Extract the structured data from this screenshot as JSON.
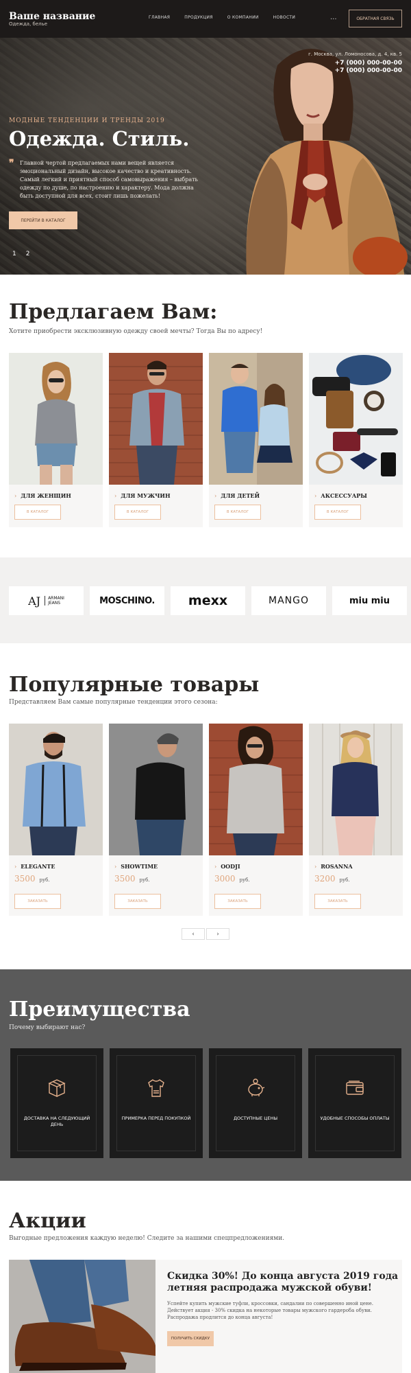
{
  "header": {
    "title": "Ваше название",
    "subtitle": "Одежда, белье",
    "nav": [
      "Главная",
      "Продукция",
      "О компании",
      "Новости"
    ],
    "more": "...",
    "callback_label": "Обратная связь"
  },
  "hero": {
    "address": "г. Москва, ул. Ломоносова, д. 4, кв. 5",
    "phones": [
      "+7 (000) 000-00-00",
      "+7 (000) 000-00-00"
    ],
    "tagline": "Модные тенденции и тренды 2019",
    "title": "Одежда. Стиль.",
    "quote_mark": "❞",
    "quote": "Главной чертой предлагаемых нами вещей является эмоциональный дизайн, высокое качество и креативность. Самый легкий и приятный способ самовыражения – выбрать одежду по душе, по настроению и характеру. Мода должна быть доступной для всех, стоит лишь пожелать!",
    "button_label": "Перейти в каталог",
    "slides": [
      "1",
      "2"
    ]
  },
  "offer": {
    "title": "Предлагаем Вам:",
    "subtitle": "Хотите приобрести эксклюзивную одежду своей мечты? Тогда Вы по адресу!",
    "cards": [
      {
        "name": "Для женщин",
        "button": "В каталог"
      },
      {
        "name": "Для мужчин",
        "button": "В каталог"
      },
      {
        "name": "Для детей",
        "button": "В каталог"
      },
      {
        "name": "Аксессуары",
        "button": "В каталог"
      }
    ]
  },
  "brands": [
    {
      "mark": "AJ",
      "name": "ARMANI",
      "sub": "JEANS"
    },
    {
      "name": "MOSCHINO."
    },
    {
      "name": "mexx"
    },
    {
      "name": "MANGO"
    },
    {
      "name": "miu miu"
    }
  ],
  "popular": {
    "title": "Популярные товары",
    "subtitle": "Представляем Вам самые популярные тенденции этого сезона:",
    "currency": "руб.",
    "items": [
      {
        "name": "Elegante",
        "price": "3500",
        "button": "Заказать"
      },
      {
        "name": "Showtime",
        "price": "3500",
        "button": "Заказать"
      },
      {
        "name": "Oodji",
        "price": "3000",
        "button": "Заказать"
      },
      {
        "name": "Rosanna",
        "price": "3200",
        "button": "Заказать"
      }
    ],
    "pager": [
      "‹",
      "›"
    ]
  },
  "advantages": {
    "title": "Преимущества",
    "subtitle": "Почему выбирают нас?",
    "items": [
      {
        "label": "Доставка на следующий день",
        "icon": "delivery-box-icon"
      },
      {
        "label": "Примерка перед покупкой",
        "icon": "tshirt-icon"
      },
      {
        "label": "Доступные цены",
        "icon": "piggy-bank-icon"
      },
      {
        "label": "Удобные способы оплаты",
        "icon": "wallet-icon"
      }
    ]
  },
  "promo": {
    "title": "Акции",
    "subtitle": "Выгодные предложения каждую неделю! Следите за нашими спецпредложениями.",
    "card_title": "Скидка 30%! До конца августа 2019 года летняя распродажа мужской обуви!",
    "card_text": "Успейте купить мужские туфли, кроссовки, сандалии по совершенно иной цене. Действует акция - 30% скидка на некоторые товары мужского гардероба обуви. Распродажа продлится до конца августа!",
    "button_label": "Получить скидку"
  }
}
